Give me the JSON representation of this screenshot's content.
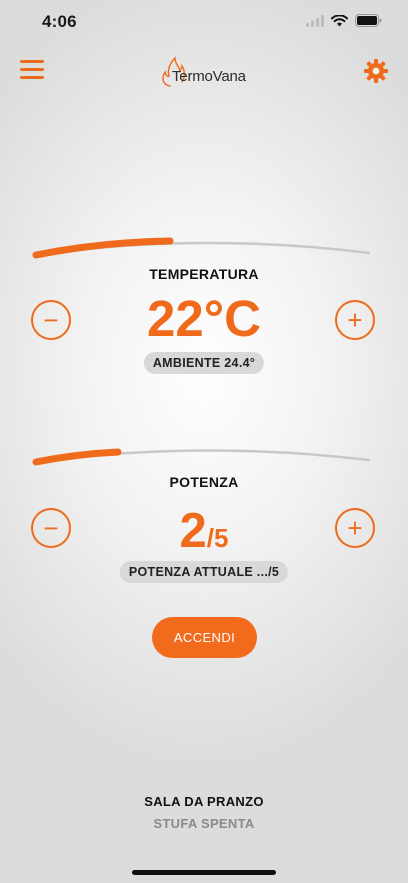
{
  "status_bar": {
    "time": "4:06"
  },
  "header": {
    "logo_text": "TermoVana"
  },
  "temperature": {
    "label": "TEMPERATURA",
    "value": "22°C",
    "ambient": "AMBIENTE 24.4°",
    "level_fraction": 0.4
  },
  "power": {
    "label": "POTENZA",
    "value": "2",
    "max": "/5",
    "current": "POTENZA ATTUALE .../5",
    "level_fraction": 0.25
  },
  "actions": {
    "accendi_label": "ACCENDI"
  },
  "footer": {
    "room": "SALA DA PRANZO",
    "status": "STUFA SPENTA"
  },
  "colors": {
    "accent": "#f06a1c",
    "track": "#c8c8c8"
  },
  "icons": [
    "signal-icon",
    "wifi-icon",
    "battery-icon",
    "menu-icon",
    "flame-logo-icon",
    "gear-icon",
    "minus-icon",
    "plus-icon"
  ]
}
